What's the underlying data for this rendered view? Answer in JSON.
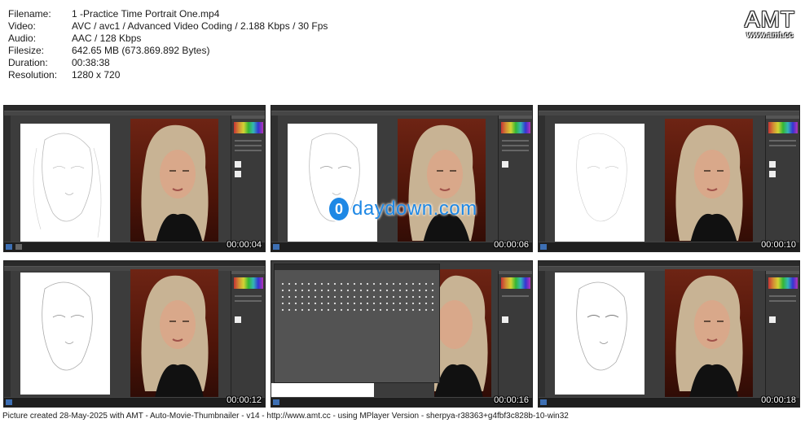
{
  "info": [
    {
      "key": "Filename:",
      "value": "1 -Practice Time Portrait One.mp4"
    },
    {
      "key": "Video:",
      "value": "AVC / avc1 / Advanced Video Coding / 2.188 Kbps / 30 Fps"
    },
    {
      "key": "Audio:",
      "value": "AAC / 128 Kbps"
    },
    {
      "key": "Filesize:",
      "value": "642.65 MB (673.869.892 Bytes)"
    },
    {
      "key": "Duration:",
      "value": "00:38:38"
    },
    {
      "key": "Resolution:",
      "value": "1280 x 720"
    }
  ],
  "logo": {
    "main": "AMT",
    "sub": "www.amt.cc"
  },
  "thumbnails": [
    {
      "timestamp": "00:00:04"
    },
    {
      "timestamp": "00:00:06"
    },
    {
      "timestamp": "00:00:10"
    },
    {
      "timestamp": "00:00:12"
    },
    {
      "timestamp": "00:00:16"
    },
    {
      "timestamp": "00:00:18"
    }
  ],
  "watermark": {
    "icon": "0",
    "text": "daydown.com"
  },
  "footer": "Picture created 28-May-2025 with AMT - Auto-Movie-Thumbnailer - v14 - http://www.amt.cc - using MPlayer Version - sherpya-r38363+g4fbf3c828b-10-win32"
}
